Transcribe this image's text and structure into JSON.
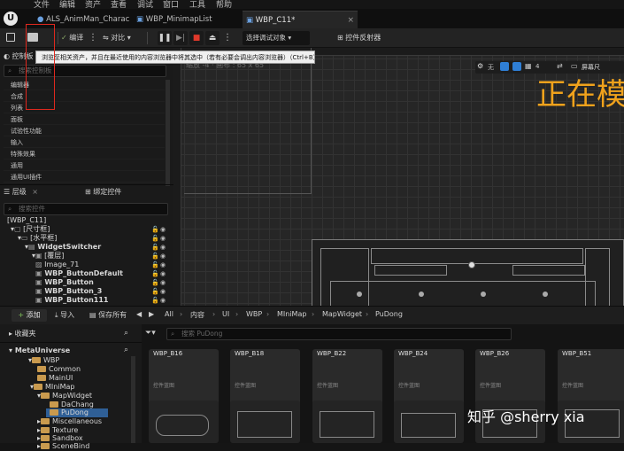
{
  "menubar": {
    "items": [
      "文件",
      "编辑",
      "资产",
      "查看",
      "调试",
      "窗口",
      "工具",
      "帮助"
    ]
  },
  "tabs": [
    {
      "label": "ALS_AnimMan_Charac..."
    },
    {
      "label": "WBP_MinimapList"
    },
    {
      "label": "WBP_C11*"
    }
  ],
  "toolbar": {
    "browse_label": "编译",
    "diff_label": "对比",
    "debug_select": "选择调试对象",
    "reflector_label": "控件反射器"
  },
  "tooltip": {
    "text": "浏览至相关资产，并且在最近使用的内容浏览器中将其选中（若有必要会调出内容浏览器）（Ctrl+B）"
  },
  "palette": {
    "tab": "控制板",
    "search_placeholder": "搜索控制板",
    "categories": [
      "编辑器",
      "合成",
      "列表",
      "面板",
      "试验性功能",
      "输入",
      "特殊效果",
      "通用",
      "通用UI插件"
    ]
  },
  "hierarchy": {
    "tab": "层级",
    "bind_tab": "绑定控件",
    "search_placeholder": "搜索控件",
    "items": [
      "[WBP_C11]",
      "[尺寸框]",
      "[水平框]",
      "WidgetSwitcher",
      "[覆层]",
      "Image_71",
      "WBP_ButtonDefault",
      "WBP_Button",
      "WBP_Button_3",
      "WBP_Button111"
    ]
  },
  "viewport": {
    "dpi_text": "缩放 -4 · 画布 : 65 x 65",
    "overlay_text": "正在模",
    "screen_label": "屏幕尺",
    "no_label": "无"
  },
  "contentbar": {
    "add_label": "添加",
    "import_label": "导入",
    "saveall_label": "保存所有",
    "breadcrumbs": [
      "All",
      "内容",
      "UI",
      "WBP",
      "MIniMap",
      "MapWidget",
      "PuDong"
    ]
  },
  "folders": {
    "favorites": "收藏夹",
    "root": "MetaUniverse",
    "items": [
      "WBP",
      "Common",
      "MainUI",
      "MIniMap",
      "MapWidget",
      "DaChang",
      "PuDong",
      "Miscellaneous",
      "Texture",
      "Sandbox",
      "SceneBind"
    ]
  },
  "assets": {
    "search_placeholder": "搜索 PuDong",
    "cards": [
      {
        "name": "WBP_B16",
        "type": "控件蓝图"
      },
      {
        "name": "WBP_B18",
        "type": "控件蓝图"
      },
      {
        "name": "WBP_B22",
        "type": "控件蓝图"
      },
      {
        "name": "WBP_B24",
        "type": "控件蓝图"
      },
      {
        "name": "WBP_B26",
        "type": "控件蓝图"
      },
      {
        "name": "WBP_B51",
        "type": "控件蓝图"
      }
    ]
  },
  "watermark": "知乎 @sherry xia"
}
